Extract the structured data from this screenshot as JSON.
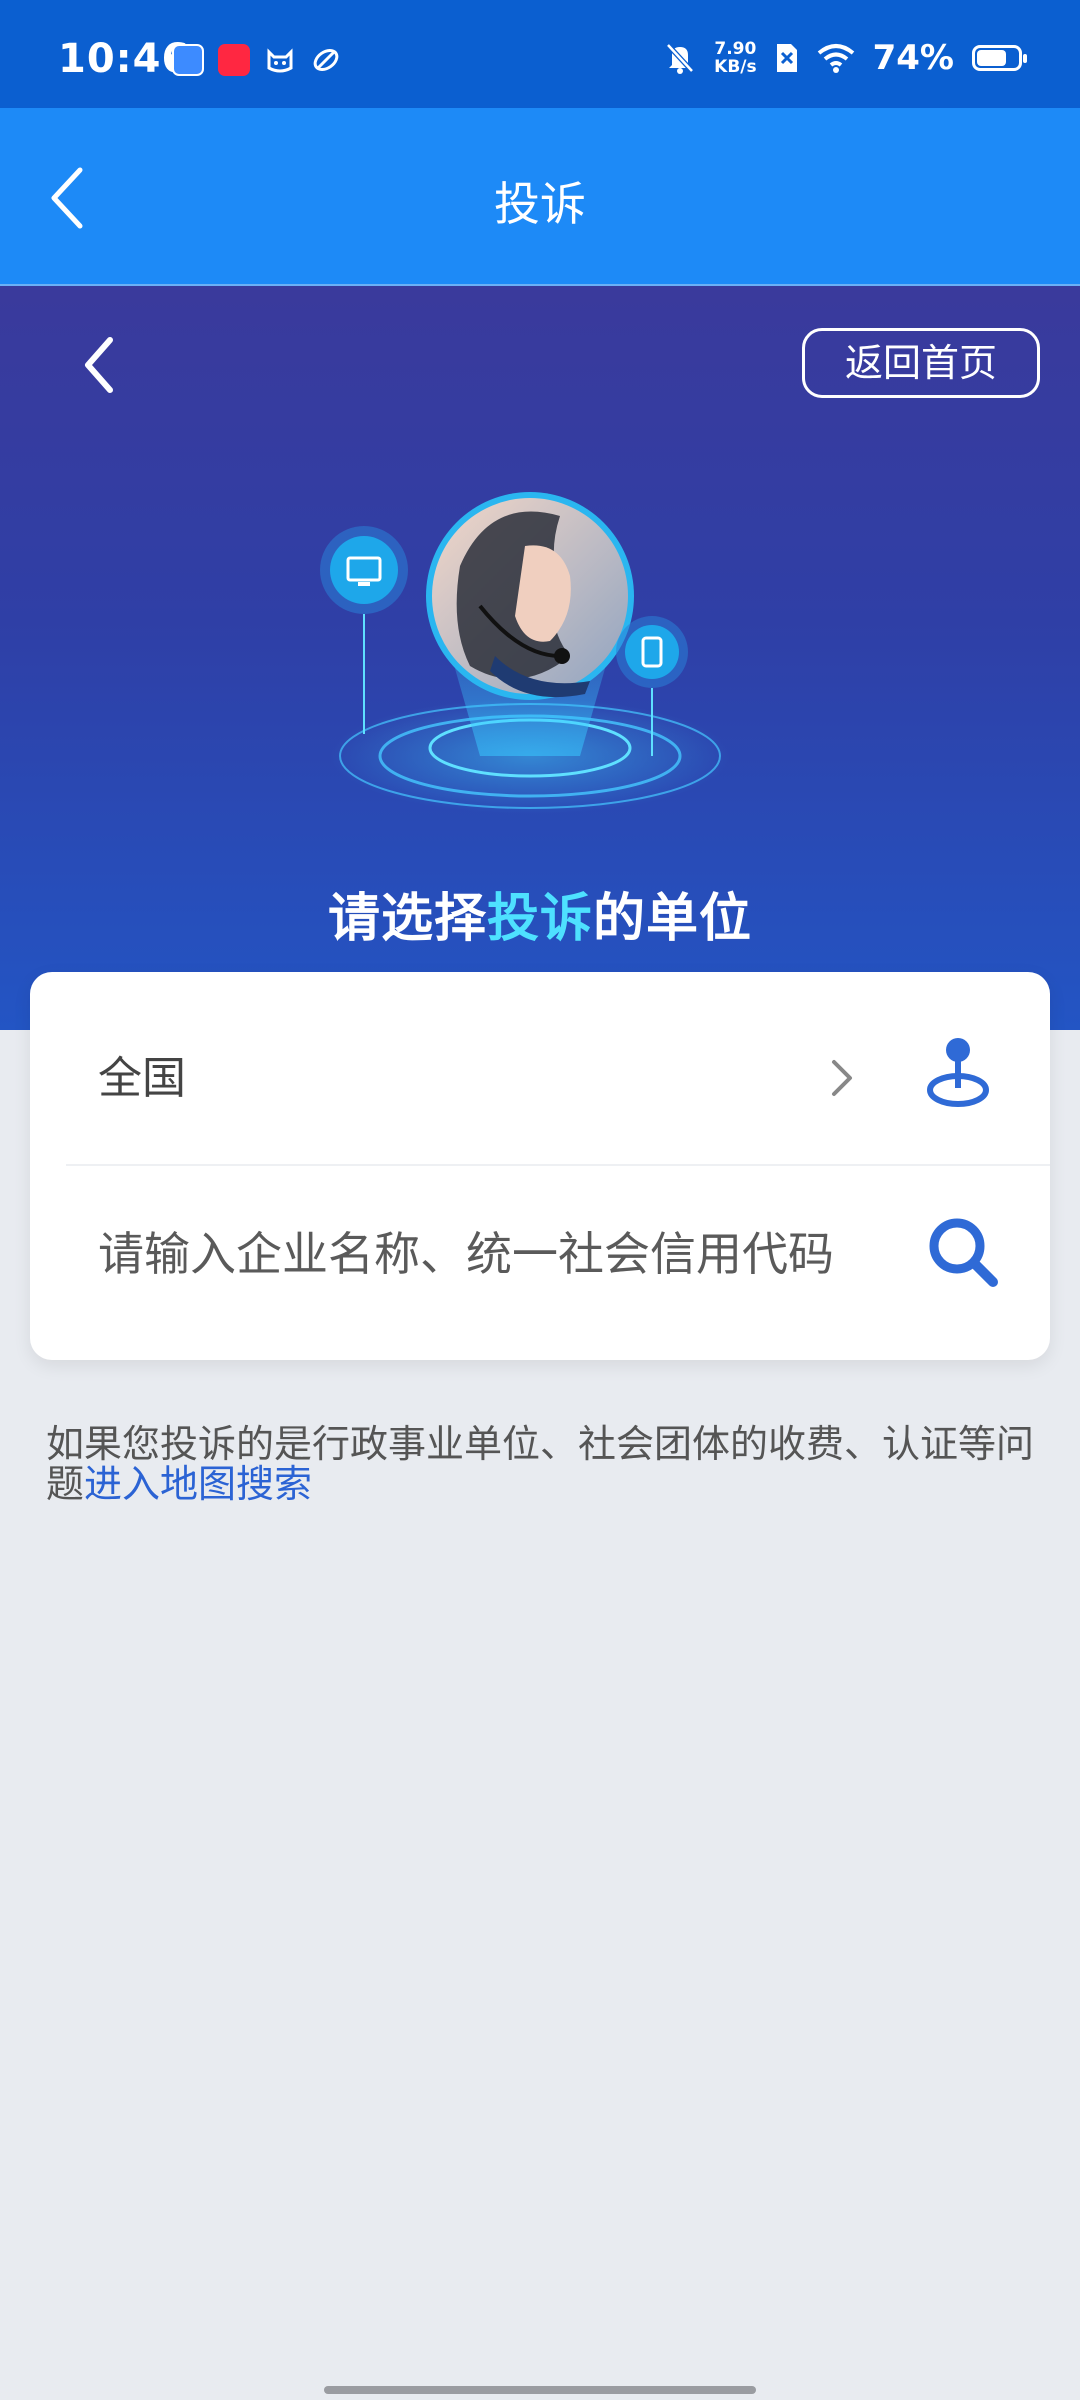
{
  "status_bar": {
    "time": "10:46",
    "net_speed_value": "7.90",
    "net_speed_unit": "KB/s",
    "battery": "74%",
    "battery_level": 0.74,
    "app_icons": [
      "app-icon-1",
      "app-icon-xiaohongshu",
      "app-icon-cat",
      "app-icon-swirl"
    ]
  },
  "nav": {
    "title": "投诉",
    "back_icon": "chevron-left-icon"
  },
  "hero": {
    "home_button": "返回首页",
    "heading_before": "请选择",
    "heading_highlight": "投诉",
    "heading_after": "的单位"
  },
  "card": {
    "region_label": "全国",
    "search_placeholder": "请输入企业名称、统一社会信用代码",
    "search_value": ""
  },
  "hint": {
    "text": "如果您投诉的是行政事业单位、社会团体的收费、认证等问题",
    "link": "进入地图搜索"
  },
  "colors": {
    "status_bar": "#0b5fd0",
    "nav_bar": "#1d8af7",
    "hero_top": "#3a3a9c",
    "hero_bottom": "#2355c4",
    "highlight": "#4ee1ff",
    "link": "#2b63d4",
    "page_bg": "#e8ebf0"
  }
}
